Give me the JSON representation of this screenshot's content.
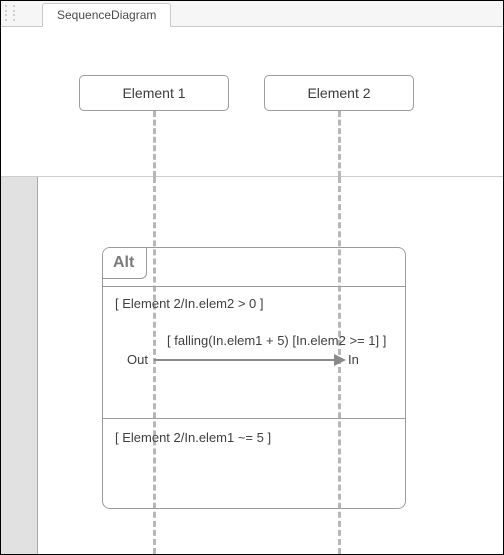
{
  "tab": {
    "label": "SequenceDiagram"
  },
  "lifelines": [
    {
      "name": "Element 1"
    },
    {
      "name": "Element 2"
    }
  ],
  "fragment": {
    "operator": "Alt",
    "operands": [
      {
        "guard": "[ Element 2/In.elem2 > 0 ]",
        "message": {
          "text": "[ falling(In.elem1 + 5) [In.elem2 >= 1] ]",
          "from_label": "Out",
          "to_label": "In"
        }
      },
      {
        "guard": "[ Element 2/In.elem1 ~= 5 ]"
      }
    ]
  }
}
